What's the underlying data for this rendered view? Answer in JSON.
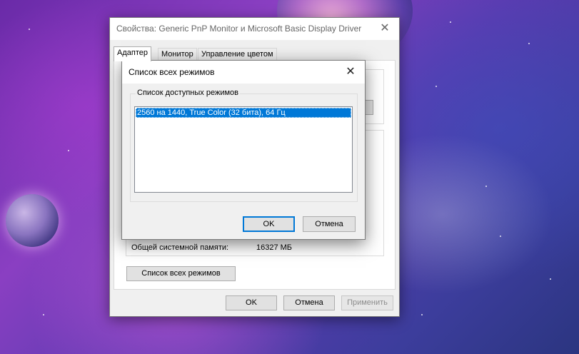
{
  "main_window": {
    "title": "Свойства: Generic PnP Monitor и Microsoft Basic Display Driver",
    "close_glyph": "✕",
    "tabs": [
      {
        "label": "Адаптер",
        "active": true
      },
      {
        "label": "Монитор",
        "active": false
      },
      {
        "label": "Управление цветом",
        "active": false
      }
    ],
    "memory": {
      "label": "Общей системной памяти:",
      "value": "16327 МБ"
    },
    "list_all_modes_button": "Список всех режимов",
    "ok_button": "OK",
    "cancel_button": "Отмена",
    "apply_button": "Применить"
  },
  "dialog": {
    "title": "Список всех режимов",
    "close_glyph": "✕",
    "group_label": "Список доступных режимов",
    "modes": [
      {
        "label": "2560 на 1440, True Color (32 бита), 64 Гц",
        "selected": true
      }
    ],
    "ok_button": "OK",
    "cancel_button": "Отмена"
  },
  "colors": {
    "accent": "#0078d7",
    "window_bg": "#f0f0f0",
    "title_bar_bg": "#ffffff"
  }
}
